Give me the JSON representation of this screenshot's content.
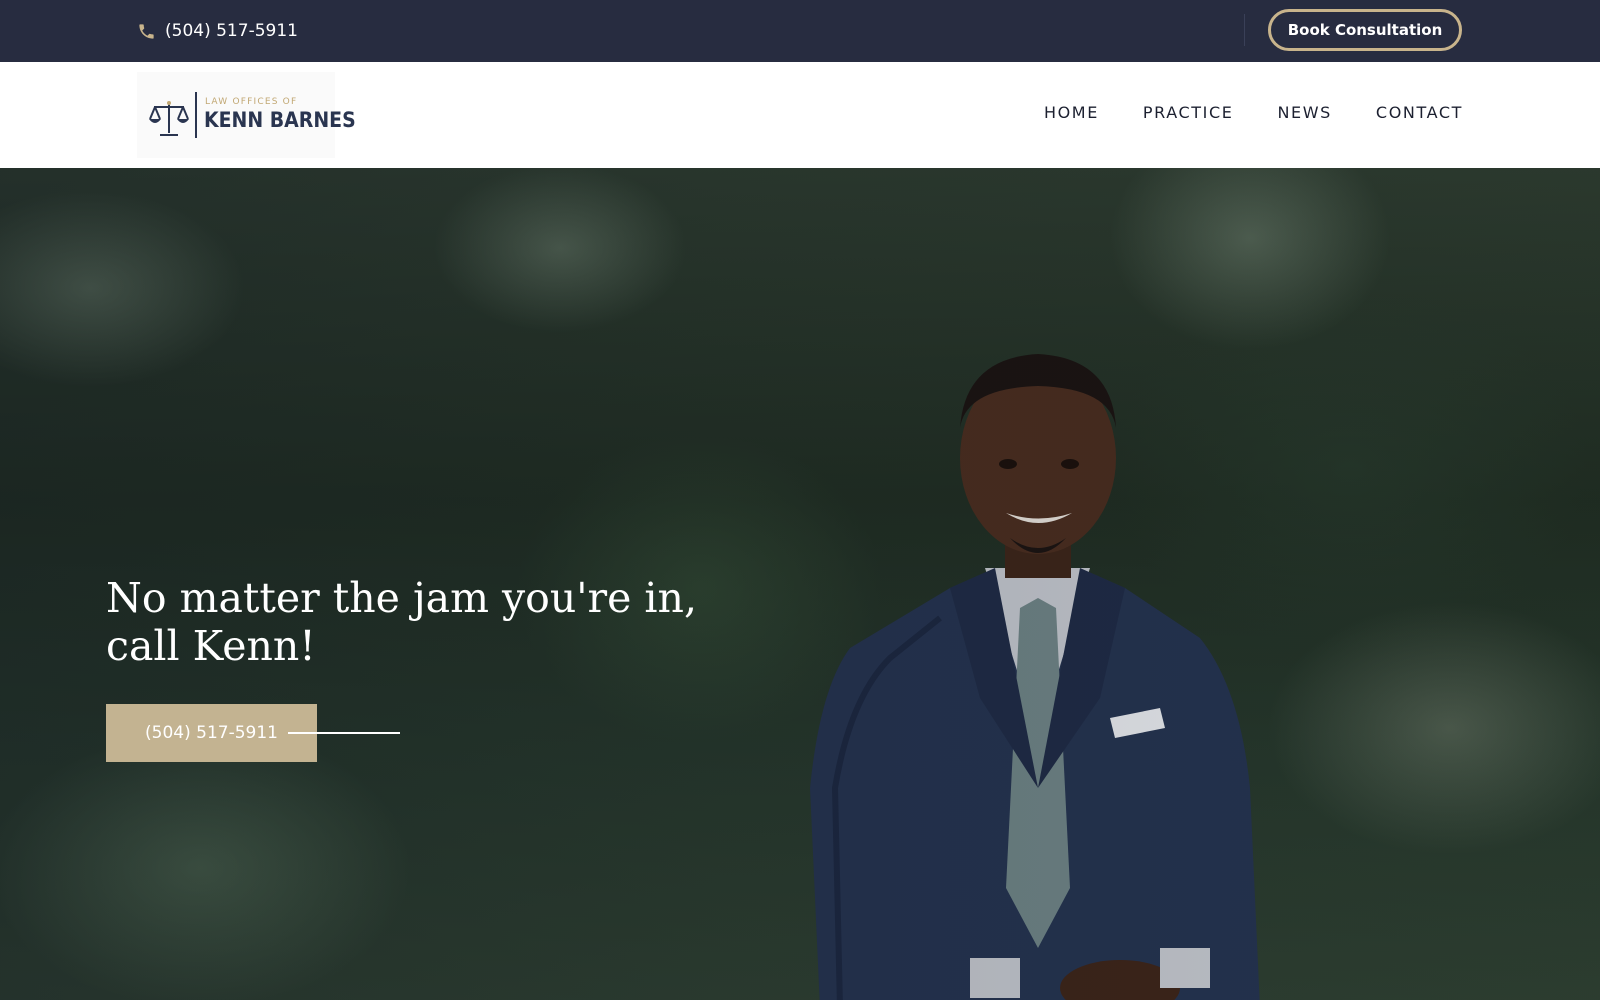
{
  "topbar": {
    "phone_icon": "phone-icon",
    "phone": "(504) 517-5911",
    "book_label": "Book Consultation"
  },
  "logo": {
    "icon": "scales-of-justice-icon",
    "small": "LAW OFFICES OF",
    "name": "KENN BARNES"
  },
  "nav": {
    "items": [
      {
        "label": "HOME"
      },
      {
        "label": "PRACTICE"
      },
      {
        "label": "NEWS"
      },
      {
        "label": "CONTACT"
      }
    ]
  },
  "hero": {
    "headline_line1": "No matter the jam you're in,",
    "headline_line2": "call Kenn!",
    "cta_label": "(504) 517-5911"
  },
  "colors": {
    "topbar_bg": "#272c40",
    "accent_gold": "#c8b48c",
    "navy": "#2a3550"
  }
}
